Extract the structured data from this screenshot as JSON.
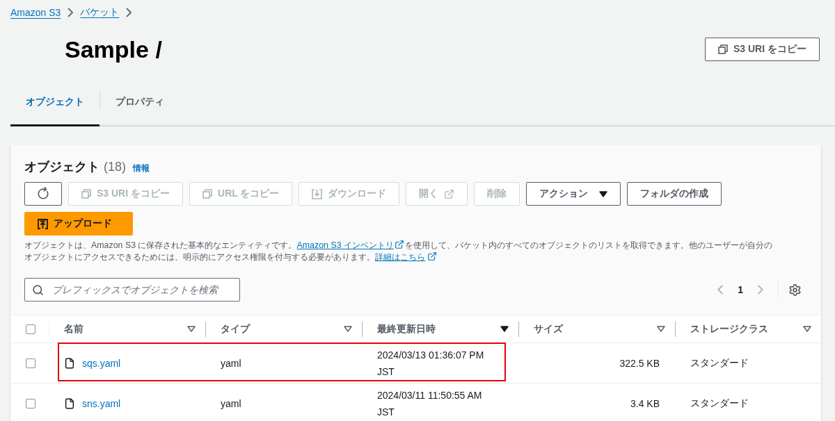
{
  "breadcrumbs": [
    "Amazon S3",
    "バケット"
  ],
  "title": "Sample /",
  "header_button": {
    "label": "S3 URI をコピー",
    "kind": "copy",
    "disabled": false
  },
  "tabs": [
    {
      "label": "オブジェクト",
      "selected": true
    },
    {
      "label": "プロパティ",
      "selected": false
    }
  ],
  "objects_panel": {
    "title": "オブジェクト",
    "count": "(18)",
    "info_link": "情報",
    "toolbar": [
      {
        "kind": "refresh",
        "disabled": false
      },
      {
        "kind": "copy",
        "label": "S3 URI をコピー",
        "disabled": true
      },
      {
        "kind": "copy",
        "label": "URL をコピー",
        "disabled": true
      },
      {
        "kind": "download",
        "label": "ダウンロード",
        "disabled": true
      },
      {
        "kind": "open",
        "label": "開く",
        "disabled": true
      },
      {
        "kind": "plain",
        "label": "削除",
        "disabled": true
      },
      {
        "kind": "menu",
        "label": "アクション",
        "disabled": false
      },
      {
        "kind": "plain",
        "label": "フォルダの作成",
        "disabled": false
      }
    ],
    "upload_button": "アップロード",
    "description": {
      "text_1": "オブジェクトは、Amazon S3 に保存された基本的なエンティティです。",
      "link_1": "Amazon S3 インベントリ",
      "text_2": "を使用して、バケット内のすべてのオブジェクトのリストを取得できます。他のユーザーが自分のオブジェクトにアクセスできるためには、明示的にアクセス権限を付与する必要があります。",
      "link_2": "詳細はこちら"
    },
    "search": {
      "placeholder": "プレフィックスでオブジェクトを検索"
    },
    "pagination": {
      "page": "1"
    },
    "table": {
      "select_all": {
        "checked": false
      },
      "columns": [
        {
          "label": "名前",
          "sorted": false
        },
        {
          "label": "タイプ",
          "sorted": false
        },
        {
          "label": "最終更新日時",
          "sorted": true
        },
        {
          "label": "サイズ",
          "sorted": false
        },
        {
          "label": "ストレージクラス",
          "sorted": false
        }
      ],
      "rows": [
        {
          "name": "sqs.yaml",
          "type": "yaml",
          "modified": "2024/03/13 01:36:07 PM JST",
          "size": "322.5 KB",
          "storage_class": "スタンダード",
          "checked": false,
          "highlighted": true
        },
        {
          "name": "sns.yaml",
          "type": "yaml",
          "modified": "2024/03/11 11:50:55 AM JST",
          "size": "3.4 KB",
          "storage_class": "スタンダード",
          "checked": false,
          "highlighted": false
        }
      ]
    }
  }
}
